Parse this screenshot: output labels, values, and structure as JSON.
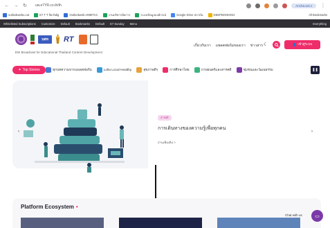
{
  "browser": {
    "url": "uw.e7YR.co.th/th",
    "profile_label": "Ancha.sen.t",
    "bookmarks": [
      {
        "label": "outlookwebu.cut",
        "color": "#2f6fd6"
      },
      {
        "label": "E7 T T fla thdig",
        "color": "#1da05b"
      },
      {
        "label": "Outlookweb AMM7CC",
        "color": "#2f6fd6"
      },
      {
        "label": "งานบริหารจัดการ",
        "color": "#1da05b"
      },
      {
        "label": "ระบบข้อมูลองค์กรณ์",
        "color": "#1da05b"
      },
      {
        "label": "Google Drive สถาบัน",
        "color": "#4285f4"
      },
      {
        "label": "DEEPBOOKING",
        "color": "#f0b300"
      }
    ],
    "bookmarks_right": "All Bookmarks",
    "dark_items": [
      "Whitelisted Subscriptions",
      "Customize",
      "Default",
      "Bookmarks",
      "Default",
      "E7 Sunday",
      "Menu"
    ],
    "dark_right": "Everything"
  },
  "header": {
    "logo_text": "RT",
    "badge_text": "บสท",
    "tagline": "EW Broadcast for Educational Thailand Content Development",
    "nav": [
      "เกี่ยวกับเรา",
      "แพลตฟอร์มของเรา",
      "ข่าวสาร"
    ],
    "login_label": "เข้าสู่ระบบ"
  },
  "categories": {
    "top_stories": "Top Stories",
    "items": [
      {
        "label": "ทุกบทความจากแพลตฟอร์ม",
        "color": "#4a78d0"
      },
      {
        "label": "Lolla Local Healthy",
        "color": "#3a9ad9"
      },
      {
        "label": "สุขภาพดีๆ",
        "color": "#e6a23c"
      },
      {
        "label": "การศึกษาไทย",
        "color": "#ef2d6a"
      },
      {
        "label": "ภาพยนตร์และสารคดี",
        "color": "#3fb27f"
      },
      {
        "label": "ชุมชนและวัฒนธรรม",
        "color": "#7b3aa8"
      }
    ]
  },
  "hero": {
    "badge": "สารคดี",
    "title": "การเดินทางของความรู้เพื่อทุกคน",
    "more": "อ่านเพิ่มเติม >"
  },
  "platform": {
    "title": "Platform Ecosystem",
    "chat_label": "Chat with us"
  }
}
